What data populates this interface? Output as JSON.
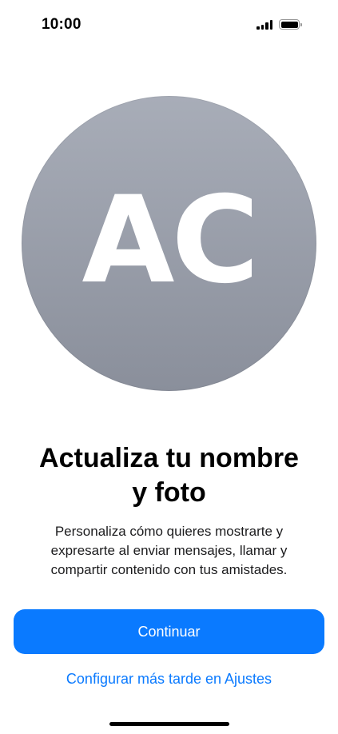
{
  "status_bar": {
    "time": "10:00",
    "signal_icon": "cellular-signal-icon",
    "battery_icon": "battery-icon"
  },
  "avatar": {
    "initials": "AC"
  },
  "content": {
    "title_line1": "Actualiza tu nombre",
    "title_line2": "y foto",
    "description": "Personaliza cómo quieres mostrarte y expresarte al enviar mensajes, llamar y compartir contenido con tus amistades."
  },
  "actions": {
    "continue_label": "Continuar",
    "later_label": "Configurar más tarde en Ajustes"
  },
  "colors": {
    "accent": "#0a7aff",
    "avatar_top": "#a8adb8",
    "avatar_bottom": "#8a8f9b"
  }
}
